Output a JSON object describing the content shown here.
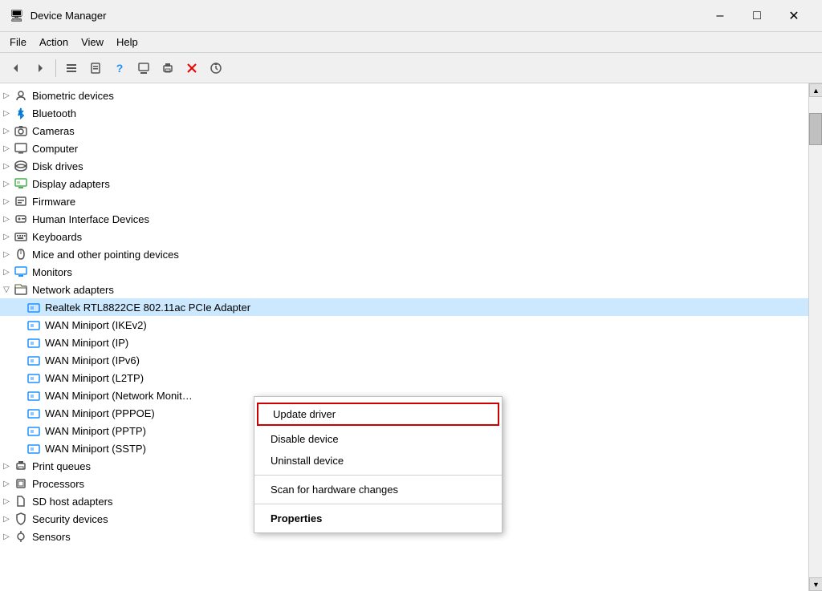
{
  "titleBar": {
    "icon": "🖥",
    "title": "Device Manager",
    "minimizeLabel": "–",
    "maximizeLabel": "□",
    "closeLabel": "✕"
  },
  "menuBar": {
    "items": [
      "File",
      "Action",
      "View",
      "Help"
    ]
  },
  "toolbar": {
    "buttons": [
      "←",
      "→",
      "≡",
      "📋",
      "?",
      "📋",
      "🖥",
      "🖨",
      "✖",
      "⬇"
    ]
  },
  "treeItems": [
    {
      "id": "biometric",
      "level": 0,
      "expanded": false,
      "label": "Biometric devices",
      "icon": "biometric"
    },
    {
      "id": "bluetooth",
      "level": 0,
      "expanded": false,
      "label": "Bluetooth",
      "icon": "bluetooth"
    },
    {
      "id": "cameras",
      "level": 0,
      "expanded": false,
      "label": "Cameras",
      "icon": "camera"
    },
    {
      "id": "computer",
      "level": 0,
      "expanded": false,
      "label": "Computer",
      "icon": "computer"
    },
    {
      "id": "disk",
      "level": 0,
      "expanded": false,
      "label": "Disk drives",
      "icon": "disk"
    },
    {
      "id": "display",
      "level": 0,
      "expanded": false,
      "label": "Display adapters",
      "icon": "display"
    },
    {
      "id": "firmware",
      "level": 0,
      "expanded": false,
      "label": "Firmware",
      "icon": "firmware"
    },
    {
      "id": "hid",
      "level": 0,
      "expanded": false,
      "label": "Human Interface Devices",
      "icon": "hid"
    },
    {
      "id": "keyboards",
      "level": 0,
      "expanded": false,
      "label": "Keyboards",
      "icon": "keyboard"
    },
    {
      "id": "mice",
      "level": 0,
      "expanded": false,
      "label": "Mice and other pointing devices",
      "icon": "mouse"
    },
    {
      "id": "monitors",
      "level": 0,
      "expanded": false,
      "label": "Monitors",
      "icon": "monitor"
    },
    {
      "id": "network",
      "level": 0,
      "expanded": true,
      "label": "Network adapters",
      "icon": "network"
    },
    {
      "id": "realtek",
      "level": 1,
      "expanded": false,
      "label": "Realtek RTL8822CE 802.11ac PCIe Adapter",
      "icon": "network",
      "selected": true
    },
    {
      "id": "wan-ikev2",
      "level": 1,
      "expanded": false,
      "label": "WAN Miniport (IKEv2)",
      "icon": "network"
    },
    {
      "id": "wan-ip",
      "level": 1,
      "expanded": false,
      "label": "WAN Miniport (IP)",
      "icon": "network"
    },
    {
      "id": "wan-ipv6",
      "level": 1,
      "expanded": false,
      "label": "WAN Miniport (IPv6)",
      "icon": "network"
    },
    {
      "id": "wan-l2tp",
      "level": 1,
      "expanded": false,
      "label": "WAN Miniport (L2TP)",
      "icon": "network"
    },
    {
      "id": "wan-netmon",
      "level": 1,
      "expanded": false,
      "label": "WAN Miniport (Network Monit…",
      "icon": "network"
    },
    {
      "id": "wan-pppoe",
      "level": 1,
      "expanded": false,
      "label": "WAN Miniport (PPPOE)",
      "icon": "network"
    },
    {
      "id": "wan-pptp",
      "level": 1,
      "expanded": false,
      "label": "WAN Miniport (PPTP)",
      "icon": "network"
    },
    {
      "id": "wan-sstp",
      "level": 1,
      "expanded": false,
      "label": "WAN Miniport (SSTP)",
      "icon": "network"
    },
    {
      "id": "print",
      "level": 0,
      "expanded": false,
      "label": "Print queues",
      "icon": "print"
    },
    {
      "id": "processors",
      "level": 0,
      "expanded": false,
      "label": "Processors",
      "icon": "processor"
    },
    {
      "id": "sd",
      "level": 0,
      "expanded": false,
      "label": "SD host adapters",
      "icon": "sd"
    },
    {
      "id": "security",
      "level": 0,
      "expanded": false,
      "label": "Security devices",
      "icon": "security"
    },
    {
      "id": "sensors",
      "level": 0,
      "expanded": false,
      "label": "Sensors",
      "icon": "sensor"
    }
  ],
  "contextMenu": {
    "items": [
      {
        "id": "update-driver",
        "label": "Update driver",
        "bold": false,
        "highlighted": true
      },
      {
        "id": "disable-device",
        "label": "Disable device",
        "bold": false
      },
      {
        "id": "uninstall-device",
        "label": "Uninstall device",
        "bold": false
      },
      {
        "id": "sep1",
        "type": "separator"
      },
      {
        "id": "scan-hardware",
        "label": "Scan for hardware changes",
        "bold": false
      },
      {
        "id": "sep2",
        "type": "separator"
      },
      {
        "id": "properties",
        "label": "Properties",
        "bold": true
      }
    ]
  }
}
